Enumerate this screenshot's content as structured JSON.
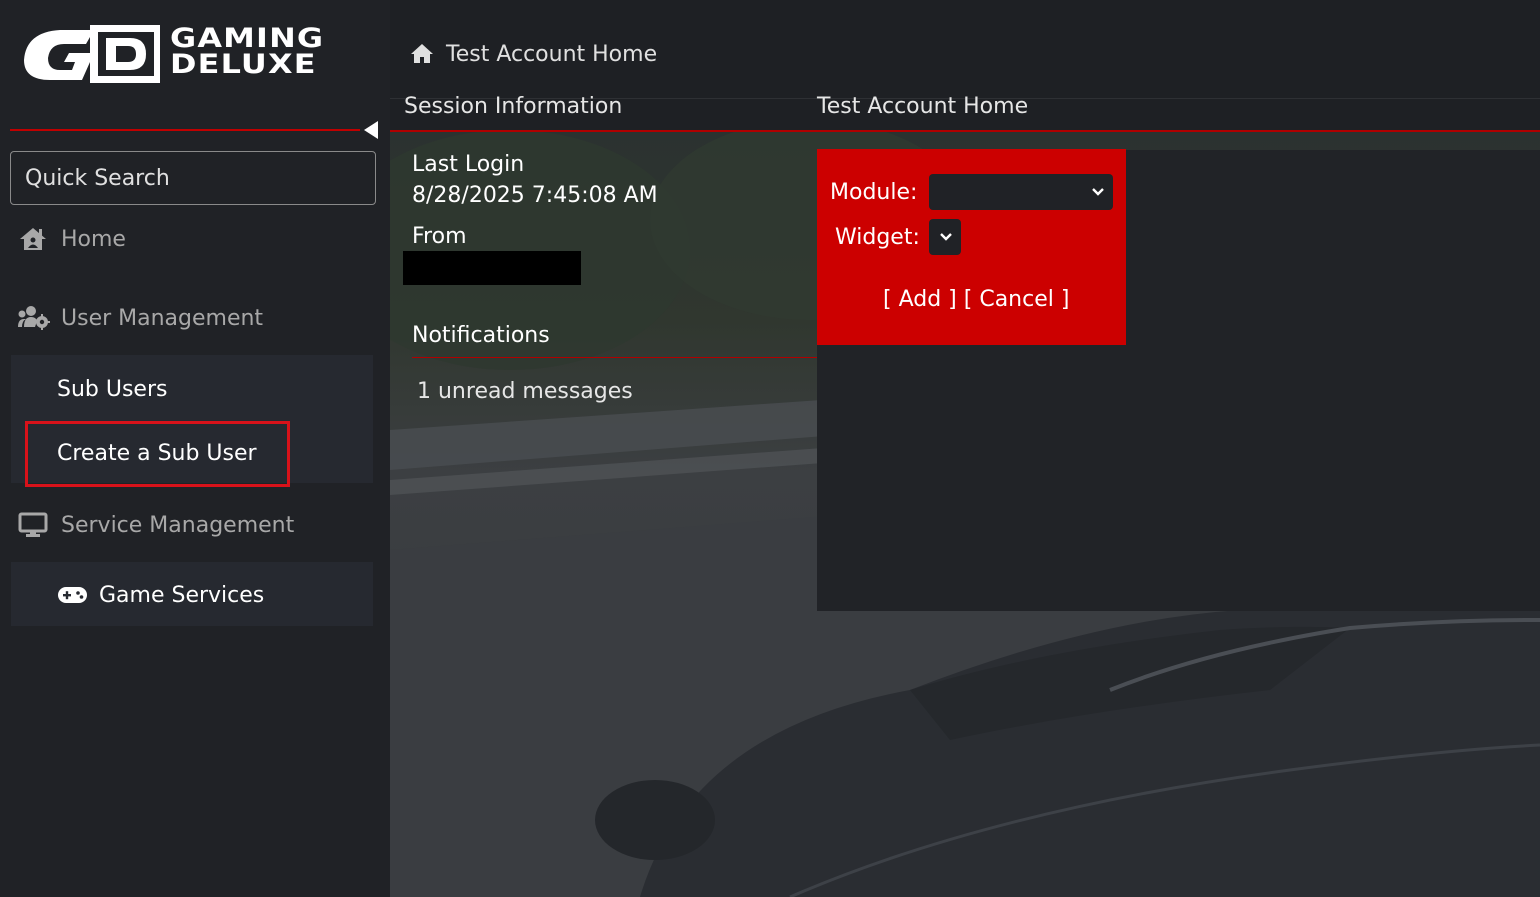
{
  "brand": {
    "logo_text_line1": "GAMING",
    "logo_text_line2": "DELUXE"
  },
  "sidebar": {
    "search": {
      "placeholder": "Quick Search",
      "value": ""
    },
    "items": [
      {
        "label": "Home",
        "icon": "home-icon"
      },
      {
        "label": "User Management",
        "icon": "users-cog-icon",
        "children": [
          {
            "label": "Sub Users"
          },
          {
            "label": "Create a Sub User",
            "highlighted": true
          }
        ]
      },
      {
        "label": "Service Management",
        "icon": "monitor-icon",
        "children": [
          {
            "label": "Game Services",
            "icon": "gamepad-icon"
          }
        ]
      }
    ]
  },
  "breadcrumb": {
    "label": "Test Account Home"
  },
  "session": {
    "title": "Session Information",
    "last_login_label": "Last Login",
    "last_login_value": "8/28/2025 7:45:08 AM",
    "from_label": "From"
  },
  "notifications": {
    "title": "Notifications",
    "message": "1 unread messages"
  },
  "home_panel": {
    "title": "Test Account Home",
    "form": {
      "module_label": "Module:",
      "module_value": "",
      "widget_label": "Widget:",
      "widget_value": "",
      "add_label": "[ Add ]",
      "cancel_label": "[ Cancel ]"
    }
  },
  "colors": {
    "accent_red": "#cc0000",
    "highlight_red": "#d8121a",
    "sidebar_bg": "#202226"
  }
}
